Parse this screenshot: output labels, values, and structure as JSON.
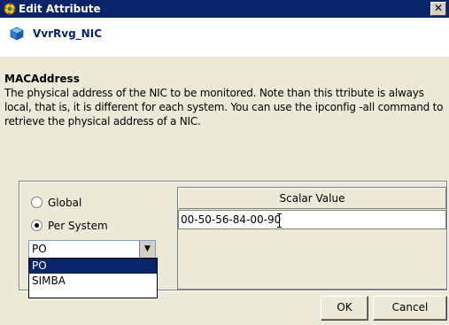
{
  "window": {
    "title": "Edit Attribute",
    "close_glyph": "✕"
  },
  "resource": {
    "name": "VvrRvg_NIC",
    "icon": "cube-icon"
  },
  "attribute": {
    "name": "MACAddress",
    "description": "The physical address of the NIC to be monitored. Note than this ttribute is always local, that is, it is different for each system. You can use the ipconfig -all command to retrieve the physical address of a NIC."
  },
  "scope": {
    "global_label": "Global",
    "per_system_label": "Per System",
    "selected": "Per System"
  },
  "system_combo": {
    "value": "PO",
    "options": [
      "PO",
      "SIMBA"
    ],
    "selected_option": "PO"
  },
  "grid": {
    "header": "Scalar Value",
    "value": "00-50-56-84-00-90"
  },
  "buttons": {
    "ok": "OK",
    "cancel": "Cancel"
  },
  "colors": {
    "titlebar": "#0a246a",
    "selection": "#0a246a",
    "dialog_bg": "#ece9d8"
  }
}
